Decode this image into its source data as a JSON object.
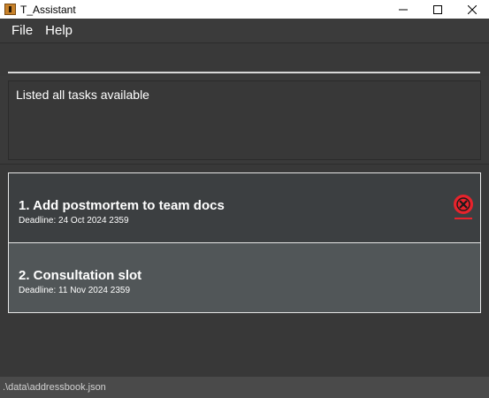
{
  "window": {
    "title": "T_Assistant"
  },
  "menu": {
    "file": "File",
    "help": "Help"
  },
  "command": {
    "value": ""
  },
  "result": {
    "message": "Listed all tasks available"
  },
  "tasks": [
    {
      "title": "1. Add postmortem to team docs",
      "deadline": "Deadline: 24 Oct 2024 2359",
      "status_icon": "overdue-icon"
    },
    {
      "title": "2. Consultation slot",
      "deadline": "Deadline: 11 Nov 2024 2359"
    }
  ],
  "status_bar": {
    "path": ".\\data\\addressbook.json"
  },
  "colors": {
    "background": "#3b3b3b",
    "card_selected": "#515658",
    "card": "#3c3f41",
    "status_red": "#e8232c"
  }
}
